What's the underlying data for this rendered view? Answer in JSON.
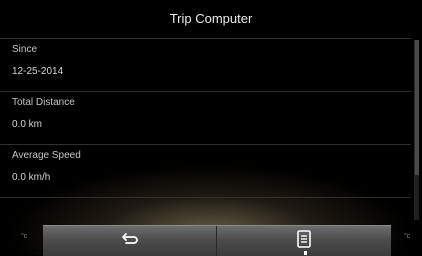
{
  "header": {
    "title": "Trip Computer"
  },
  "items": [
    {
      "label": "Since",
      "value": "12-25-2014"
    },
    {
      "label": "Total Distance",
      "value": "0.0 km"
    },
    {
      "label": "Average Speed",
      "value": "0.0 km/h"
    }
  ],
  "climate": {
    "left_unit": "°c",
    "right_unit": "°c"
  },
  "bottom_bar": {
    "back_icon": "back-arrow-icon",
    "menu_icon": "list-menu-icon"
  },
  "colors": {
    "background": "#000000",
    "text": "#d8d8d8",
    "bar": "#5a5a5a"
  }
}
